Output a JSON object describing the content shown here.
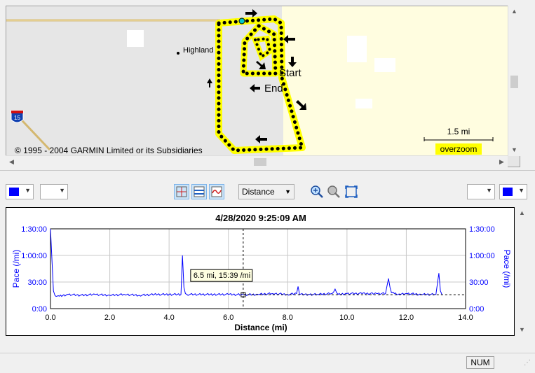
{
  "map": {
    "copyright": "© 1995 - 2004 GARMIN Limited or its Subsidiaries",
    "place_label": "Highland",
    "start_label": "Start",
    "end_label": "End",
    "scale_label": "1.5 mi",
    "zoom_badge": "overzoom",
    "highway_label": "15",
    "track_color": "#000000",
    "track_highlight": "#ffff00"
  },
  "toolbar": {
    "left_color": "#0000ff",
    "right_color": "#0000ff",
    "x_axis_select": "Distance"
  },
  "chart": {
    "title": "4/28/2020 9:25:09 AM",
    "tooltip": "6.5 mi, 15:39 /mi",
    "line_color": "#0000ff",
    "chart_data": {
      "type": "line",
      "xlabel": "Distance (mi)",
      "ylabel_left": "Pace (/mi)",
      "ylabel_right": "Pace (/mi)",
      "xlim": [
        0,
        14
      ],
      "ylim_minutes": [
        0,
        90
      ],
      "x_ticks": [
        "0.0",
        "2.0",
        "4.0",
        "6.0",
        "8.0",
        "10.0",
        "12.0",
        "14.0"
      ],
      "y_ticks": [
        "0:00",
        "30:00",
        "1:00:00",
        "1:30:00"
      ],
      "grid": true,
      "cursor_x": 6.5,
      "cursor_y_minutes": 15.65,
      "series": [
        {
          "x": [
            0.0,
            0.1,
            0.15,
            0.3,
            0.6,
            1.0,
            1.5,
            2.0,
            2.5,
            3.0,
            3.5,
            4.0,
            4.4,
            4.45,
            4.5,
            4.55,
            4.6,
            5.0,
            5.5,
            6.0,
            6.5,
            7.0,
            7.5,
            8.0,
            8.3,
            8.35,
            8.4,
            8.7,
            9.0,
            9.5,
            9.6,
            9.7,
            10.0,
            10.5,
            11.0,
            11.3,
            11.4,
            11.45,
            11.5,
            11.6,
            11.8,
            12.0,
            12.5,
            13.0,
            13.1,
            13.15,
            13.2
          ],
          "y_minutes": [
            90,
            20,
            15,
            14,
            16,
            15,
            16,
            15,
            16,
            15,
            16,
            16,
            16,
            60,
            24,
            17,
            16,
            16,
            16,
            16,
            15.65,
            16,
            17,
            16,
            17,
            25,
            16,
            16,
            16,
            17,
            22,
            16,
            17,
            17,
            17,
            17,
            34,
            24,
            18,
            17,
            16,
            17,
            16,
            16,
            40,
            20,
            16
          ]
        }
      ]
    }
  },
  "status": {
    "num_label": "NUM"
  }
}
